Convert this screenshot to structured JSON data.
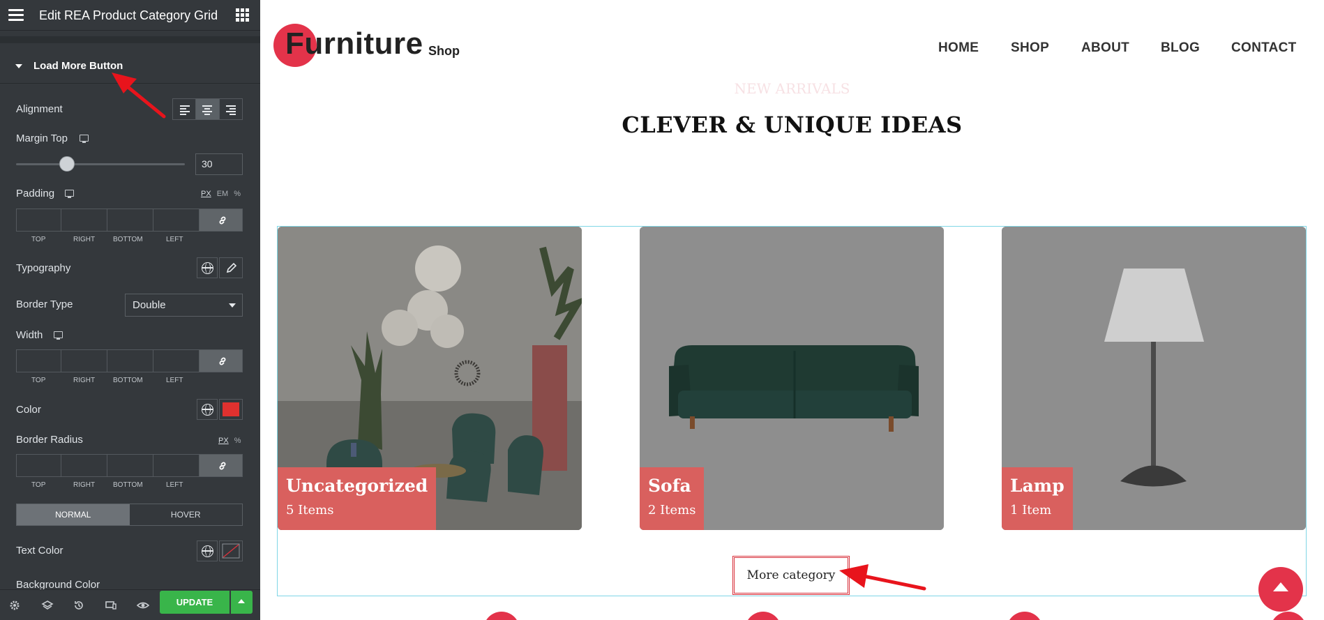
{
  "editor": {
    "title": "Edit REA Product Category Grid",
    "section_label": "Load More Button",
    "alignment_label": "Alignment",
    "margin_top_label": "Margin Top",
    "margin_top_value": "30",
    "margin_top_slider_fraction": 0.3,
    "padding_label": "Padding",
    "padding_units": [
      "PX",
      "EM",
      "%"
    ],
    "dimension_labels": [
      "TOP",
      "RIGHT",
      "BOTTOM",
      "LEFT"
    ],
    "typography_label": "Typography",
    "border_type_label": "Border Type",
    "border_type_value": "Double",
    "width_label": "Width",
    "color_label": "Color",
    "color_value": "#e0312f",
    "border_radius_label": "Border Radius",
    "border_radius_units": [
      "PX",
      "%"
    ],
    "state_tabs": [
      "NORMAL",
      "HOVER"
    ],
    "text_color_label": "Text Color",
    "partial_label": "Background Color",
    "update_label": "UPDATE"
  },
  "site": {
    "logo_main": "Furniture",
    "logo_sub": "Shop",
    "nav": [
      "HOME",
      "SHOP",
      "ABOUT",
      "BLOG",
      "CONTACT"
    ],
    "eyebrow": "NEW ARRIVALS",
    "heading": "CLEVER & UNIQUE IDEAS",
    "categories": [
      {
        "name": "Uncategorized",
        "count": "5 Items"
      },
      {
        "name": "Sofa",
        "count": "2 Items"
      },
      {
        "name": "Lamp",
        "count": "1 Item"
      }
    ],
    "more_button": "More category"
  },
  "colors": {
    "brand_red": "#e3334a",
    "badge_red": "#d9605e",
    "editor_bg": "#34383c",
    "update_green": "#39b54a"
  }
}
